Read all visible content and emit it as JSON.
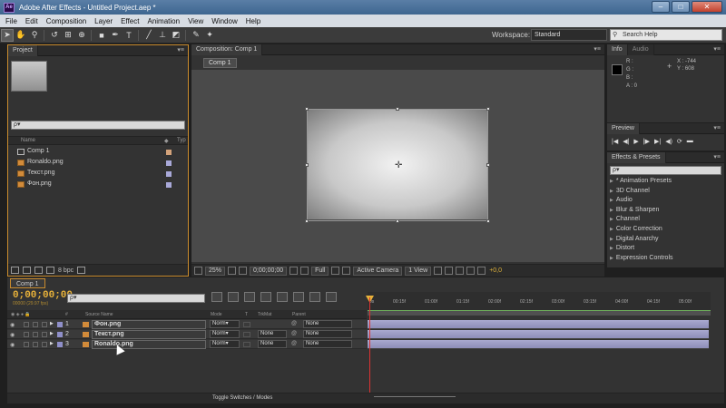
{
  "window": {
    "app_badge": "Ae",
    "title": "Adobe After Effects - Untitled Project.aep *",
    "minimize": "–",
    "maximize": "□",
    "close": "✕"
  },
  "menu": [
    "File",
    "Edit",
    "Composition",
    "Layer",
    "Effect",
    "Animation",
    "View",
    "Window",
    "Help"
  ],
  "toolbar": {
    "tools": [
      "selection-tool",
      "hand-tool",
      "zoom-tool",
      "rotate-tool",
      "camera-tool",
      "pan-behind-tool",
      "rectangle-tool",
      "pen-tool",
      "type-tool",
      "brush-tool",
      "clone-stamp-tool",
      "eraser-tool",
      "roto-brush-tool",
      "puppet-tool"
    ],
    "workspace_label": "Workspace:",
    "workspace_value": "Standard",
    "search_help": "Search Help"
  },
  "project": {
    "tab": "Project",
    "search_placeholder": "ρ▾",
    "col_name": "Name",
    "col_type": "Typ",
    "items": [
      {
        "name": "Comp 1",
        "kind": "comp",
        "tag_color": "#d3a27a"
      },
      {
        "name": "Ronaldo.png",
        "kind": "png",
        "tag_color": "#a9a9d9"
      },
      {
        "name": "Текст.png",
        "kind": "png",
        "tag_color": "#a9a9d9"
      },
      {
        "name": "Фон.png",
        "kind": "png",
        "tag_color": "#a9a9d9"
      }
    ],
    "bpc": "8 bpc"
  },
  "composition": {
    "tab": "Composition: Comp 1",
    "subtab": "Comp 1",
    "zoom": "25%",
    "timecode": "0;00;00;00",
    "resolution": "Full",
    "camera": "Active Camera",
    "views": "1 View",
    "exposure": "+0,0"
  },
  "info": {
    "tab": "Info",
    "tab2": "Audio",
    "r": "R :",
    "g": "G :",
    "b": "B :",
    "a": "A : 0",
    "x": "X : -744",
    "y": "Y : 608"
  },
  "preview": {
    "tab": "Preview",
    "controls": [
      "|◀",
      "◀|",
      "▶",
      "|▶",
      "▶|",
      "◀)",
      "⟳",
      "▬"
    ]
  },
  "effects": {
    "tab": "Effects & Presets",
    "search_placeholder": "ρ▾",
    "items": [
      "* Animation Presets",
      "3D Channel",
      "Audio",
      "Blur & Sharpen",
      "Channel",
      "Color Correction",
      "Digital Anarchy",
      "Distort",
      "Expression Controls"
    ]
  },
  "timeline": {
    "tab": "Comp 1",
    "time": "0;00;00;00",
    "fps": "00000 (29.97 fps)",
    "search_placeholder": "ρ▾",
    "col_source": "Source Name",
    "col_mode": "Mode",
    "col_t": "T",
    "col_trkmat": "TrkMat",
    "col_parent": "Parent",
    "ruler": [
      "0s",
      "00:15f",
      "01:00f",
      "01:15f",
      "02:00f",
      "02:15f",
      "03:00f",
      "03:15f",
      "04:00f",
      "04:15f",
      "05:00f"
    ],
    "layers": [
      {
        "num": "1",
        "name": "Фон.png",
        "mode": "Norm▾",
        "trkmat": "",
        "parent": "None"
      },
      {
        "num": "2",
        "name": "Текст.png",
        "mode": "Norm▾",
        "trkmat": "None",
        "parent": "None"
      },
      {
        "num": "3",
        "name": "Ronaldo.png",
        "mode": "Norm▾",
        "trkmat": "None",
        "parent": "None"
      }
    ],
    "toggle": "Toggle Switches / Modes"
  }
}
